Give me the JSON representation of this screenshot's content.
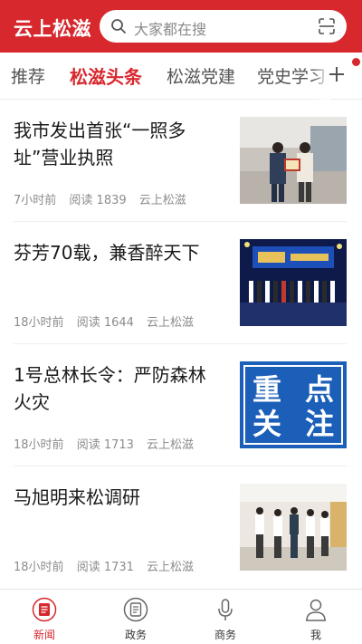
{
  "header": {
    "app_title": "云上松滋",
    "search_placeholder": "大家都在搜"
  },
  "tabs": [
    {
      "label": "推荐",
      "active": false
    },
    {
      "label": "松滋头条",
      "active": true
    },
    {
      "label": "松滋党建",
      "active": false
    },
    {
      "label": "党史学习教",
      "active": false
    }
  ],
  "news": [
    {
      "title": "我市发出首张“一照多址”营业执照",
      "time": "7小时前",
      "reads": "阅读 1839",
      "source": "云上松滋"
    },
    {
      "title": "芬芳70载，兼香醉天下",
      "time": "18小时前",
      "reads": "阅读 1644",
      "source": "云上松滋"
    },
    {
      "title": "1号总林长令：严防森林火灾",
      "time": "18小时前",
      "reads": "阅读 1713",
      "source": "云上松滋",
      "thumb_text": [
        "重",
        "点",
        "关",
        "注"
      ]
    },
    {
      "title": "马旭明来松调研",
      "time": "18小时前",
      "reads": "阅读 1731",
      "source": "云上松滋"
    }
  ],
  "bottom_nav": [
    {
      "label": "新闻",
      "icon": "news-icon",
      "active": true
    },
    {
      "label": "政务",
      "icon": "government-icon",
      "active": false
    },
    {
      "label": "商务",
      "icon": "microphone-icon",
      "active": false
    },
    {
      "label": "我",
      "icon": "user-icon",
      "active": false
    }
  ],
  "colors": {
    "brand": "#d7282e",
    "text": "#1a1a1a",
    "meta": "#8c8c8c"
  }
}
